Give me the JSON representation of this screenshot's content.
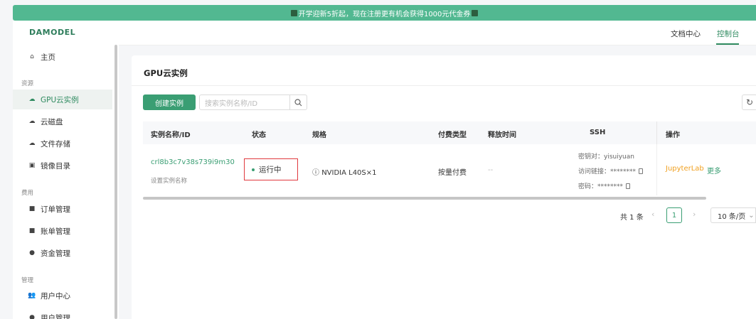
{
  "banner": {
    "text": "开学迎新5折起，现在注册更有机会获得1000元代金券"
  },
  "brand": {
    "logo": "DAMODEL"
  },
  "sidebar": {
    "home": "主页",
    "groups": [
      "资源",
      "费用",
      "管理"
    ],
    "resource_items": [
      "GPU云实例",
      "云磁盘",
      "文件存储",
      "镜像目录"
    ],
    "billing_items": [
      "订单管理",
      "账单管理",
      "资金管理"
    ],
    "manage_items": [
      "用户中心",
      "用户管理"
    ]
  },
  "topbar": {
    "docs": "文档中心",
    "console": "控制台"
  },
  "page": {
    "title": "GPU云实例",
    "create_button": "创建实例",
    "search_placeholder": "搜索实例名称/ID"
  },
  "table": {
    "columns": [
      "实例名称/ID",
      "状态",
      "规格",
      "付费类型",
      "释放时间",
      "SSH",
      "操作"
    ],
    "rows": [
      {
        "id": "crl8b3c7v38s739i9m30",
        "name_hint": "设置实例名称",
        "status": "运行中",
        "spec": "NVIDIA L40S×1",
        "billing": "按量付费",
        "release_time": "--",
        "ssh_keypair": "密钥对：yisuiyuan",
        "ssh_link": "访问链接：********",
        "ssh_password": "密码：********",
        "op_jupyter": "JupyterLab",
        "op_more": "更多"
      }
    ]
  },
  "pagination": {
    "total": "共 1 条",
    "current": "1",
    "page_size": "10 条/页"
  },
  "colors": {
    "brand_green": "#3a9e73",
    "banner_green": "#52b891",
    "highlight_red": "#e0393e",
    "op_orange": "#f0a020"
  }
}
